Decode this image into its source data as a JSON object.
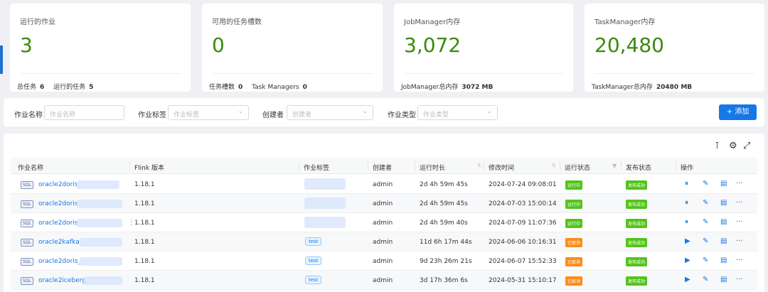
{
  "stats": [
    {
      "title": "运行的作业",
      "value": "3",
      "foot": [
        {
          "label": "总任务",
          "value": "6"
        },
        {
          "label": "运行的任务",
          "value": "5"
        }
      ]
    },
    {
      "title": "可用的任务槽数",
      "value": "0",
      "foot": [
        {
          "label": "任务槽数",
          "value": "0"
        },
        {
          "label": "Task Managers",
          "value": "0"
        }
      ]
    },
    {
      "title": "JobManager内存",
      "value": "3,072",
      "foot": [
        {
          "label": "JobManager总内存",
          "value": "3072 MB"
        }
      ]
    },
    {
      "title": "TaskManager内存",
      "value": "20,480",
      "foot": [
        {
          "label": "TaskManager总内存",
          "value": "20480 MB"
        }
      ]
    }
  ],
  "filters": [
    {
      "label": "作业名称",
      "placeholder": "作业名称"
    },
    {
      "label": "作业标签",
      "placeholder": "作业标签"
    },
    {
      "label": "创建者",
      "placeholder": "创建者"
    },
    {
      "label": "作业类型",
      "placeholder": "作业类型"
    }
  ],
  "add_button": "+ 添加",
  "toolbar": {
    "density_icon": "column-height-icon",
    "settings_icon": "gear-icon",
    "fullscreen_icon": "fullscreen-icon"
  },
  "columns": [
    "作业名称",
    "Flink 版本",
    "作业标签",
    "创建者",
    "运行时长",
    "修改时间",
    "运行状态",
    "发布状态",
    "操作"
  ],
  "rows": [
    {
      "sql": "SQL",
      "name": "oracle2doris_",
      "version": "1.18.1",
      "tag": "",
      "creator": "admin",
      "duration": "2d 4h 59m 45s",
      "modified": "2024-07-24 09:08:01",
      "run_status": "运行中",
      "publish_status": "发布成功"
    },
    {
      "sql": "SQL",
      "name": "oracle2doris",
      "version": "1.18.1",
      "tag": "",
      "creator": "admin",
      "duration": "2d 4h 59m 45s",
      "modified": "2024-07-03 15:00:14",
      "run_status": "运行中",
      "publish_status": "发布成功"
    },
    {
      "sql": "SQL",
      "name": "oracle2doris",
      "version": "1.18.1",
      "tag": "",
      "creator": "admin",
      "duration": "2d 4h 59m 40s",
      "modified": "2024-07-09 11:07:36",
      "run_status": "运行中",
      "publish_status": "发布成功"
    },
    {
      "sql": "SQL",
      "name": "oracle2kafka_",
      "version": "1.18.1",
      "tag": "test",
      "creator": "admin",
      "duration": "11d 6h 17m 44s",
      "modified": "2024-06-06 10:16:31",
      "run_status": "已取消",
      "publish_status": "发布成功"
    },
    {
      "sql": "SQL",
      "name": "oracle2doris_",
      "version": "1.18.1",
      "tag": "test",
      "creator": "admin",
      "duration": "9d 23h 26m 21s",
      "modified": "2024-06-07 15:52:33",
      "run_status": "已取消",
      "publish_status": "发布成功"
    },
    {
      "sql": "SQL",
      "name": "oracle2iceberg_",
      "version": "1.18.1",
      "tag": "test",
      "creator": "admin",
      "duration": "3d 17h 36m 6s",
      "modified": "2024-05-31 15:10:17",
      "run_status": "已取消",
      "publish_status": "发布成功"
    }
  ],
  "ops": {
    "more": "···"
  },
  "colors": {
    "running": "#52c41a",
    "canceled": "#fa8c16",
    "accent": "#1677e6",
    "stat_value": "#3a8a0c"
  }
}
